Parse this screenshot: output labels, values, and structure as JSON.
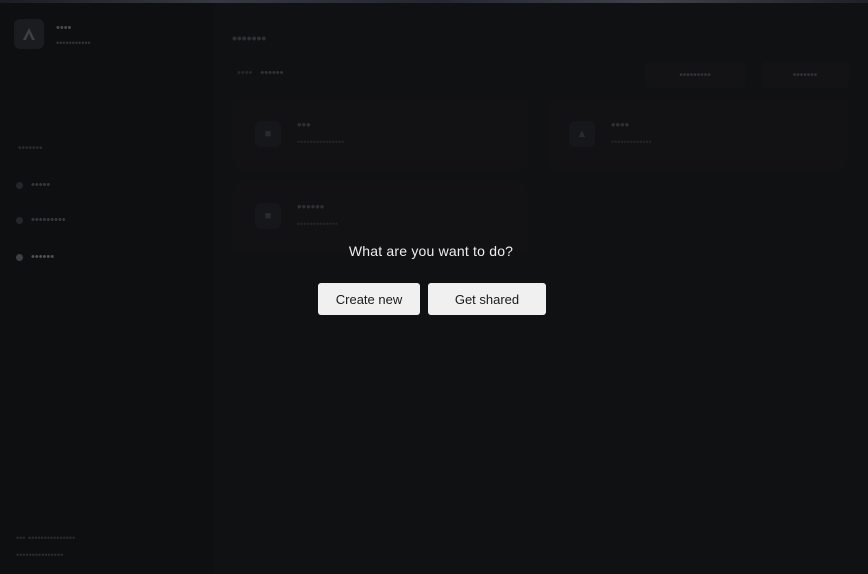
{
  "window": {
    "top_strip_colors": [
      "#2a2f3a",
      "#5a6070",
      "#6a7080"
    ]
  },
  "sidebar": {
    "logo_letter": "A",
    "app_name": "••••",
    "app_subtitle": "•••••••••••",
    "sections": [
      "•••••••"
    ],
    "items": [
      {
        "label": "•••••"
      },
      {
        "label": "•••••••••"
      },
      {
        "label": "••••••"
      }
    ],
    "footer_line1": "••• •••••••••••••••",
    "footer_line2": "•••••••••••••••"
  },
  "main": {
    "page_title": "•••••••",
    "breadcrumb": [
      "••••",
      "••••••"
    ],
    "buttons": [
      "•••••••••",
      "•••••••"
    ],
    "cards": [
      {
        "title": "•••",
        "subtitle": "•••••••••••••••"
      },
      {
        "title": "••••",
        "subtitle": "•••••••••••••"
      },
      {
        "title": "••••••",
        "subtitle": "•••••••••••••"
      }
    ]
  },
  "dialog": {
    "question": "What are you want to do?",
    "create_label": "Create new",
    "shared_label": "Get shared",
    "button_bg": "#f0f0f0"
  }
}
